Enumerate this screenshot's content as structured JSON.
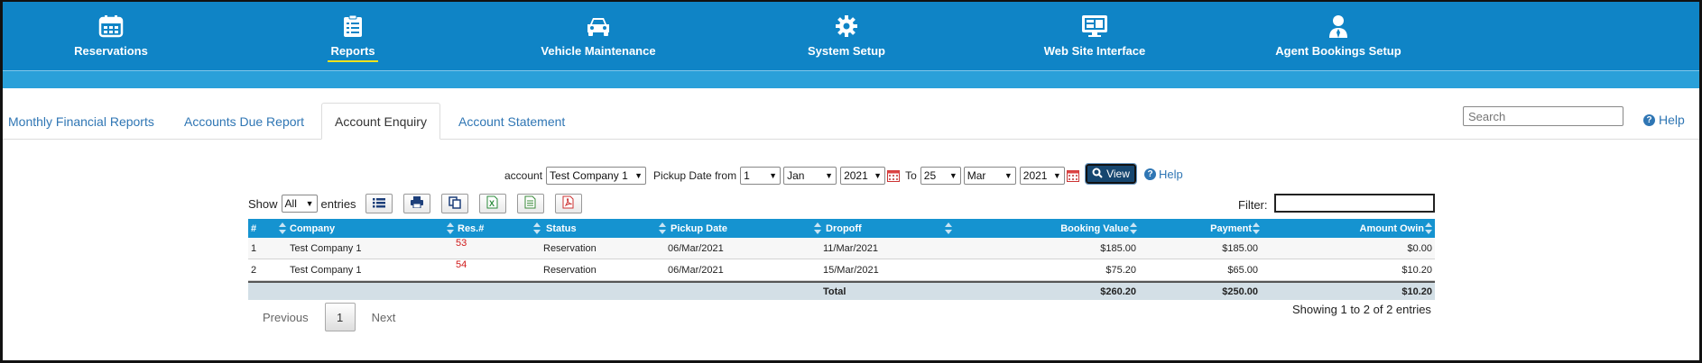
{
  "nav": {
    "items": [
      {
        "label": "Reservations",
        "icon": "calendar-icon"
      },
      {
        "label": "Reports",
        "icon": "clipboard-list-icon",
        "active": true
      },
      {
        "label": "Vehicle Maintenance",
        "icon": "car-icon"
      },
      {
        "label": "System Setup",
        "icon": "gear-icon"
      },
      {
        "label": "Web Site Interface",
        "icon": "monitor-icon"
      },
      {
        "label": "Agent Bookings Setup",
        "icon": "agent-icon"
      }
    ],
    "active_underline_color": "#f2e21b",
    "bar_color": "#0f84c6"
  },
  "tabs": [
    {
      "label": "Monthly Financial Reports"
    },
    {
      "label": "Accounts Due Report"
    },
    {
      "label": "Account Enquiry",
      "active": true
    },
    {
      "label": "Account Statement"
    }
  ],
  "search": {
    "placeholder": "Search"
  },
  "help_label": "Help",
  "filters": {
    "account_label": "account",
    "account_value": "Test Company 1",
    "pickup_label": "Pickup Date from",
    "from_day": "1",
    "from_month": "Jan",
    "from_year": "2021",
    "to_label": "To",
    "to_day": "25",
    "to_month": "Mar",
    "to_year": "2021",
    "view_label": "View",
    "help_label": "Help"
  },
  "table_controls": {
    "show_label": "Show",
    "entries_value": "All",
    "entries_label": "entries",
    "filter_label": "Filter:",
    "tools": [
      "list-icon",
      "print-icon",
      "copy-icon",
      "excel-icon",
      "csv-icon",
      "pdf-icon"
    ]
  },
  "table": {
    "columns": [
      "#",
      "Company",
      "Res.#",
      "Status",
      "Pickup Date",
      "Dropoff",
      "Booking Value",
      "Payment",
      "Amount Owin"
    ],
    "rows": [
      {
        "num": "1",
        "company": "Test Company 1",
        "res": "53",
        "status": "Reservation",
        "pickup": "06/Mar/2021",
        "dropoff": "11/Mar/2021",
        "booking": "$185.00",
        "payment": "$185.00",
        "owing": "$0.00"
      },
      {
        "num": "2",
        "company": "Test Company 1",
        "res": "54",
        "status": "Reservation",
        "pickup": "06/Mar/2021",
        "dropoff": "15/Mar/2021",
        "booking": "$75.20",
        "payment": "$65.00",
        "owing": "$10.20"
      }
    ],
    "footer": {
      "label": "Total",
      "booking": "$260.20",
      "payment": "$250.00",
      "owing": "$10.20"
    },
    "res_color": "#d01a1a"
  },
  "pagination": {
    "previous": "Previous",
    "current": "1",
    "next": "Next"
  },
  "info": "Showing 1 to 2 of 2 entries"
}
